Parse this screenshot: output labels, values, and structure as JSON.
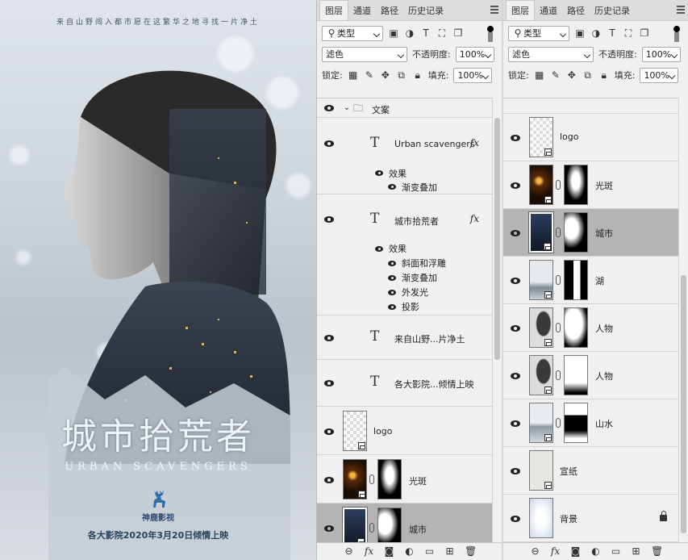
{
  "poster": {
    "tagline": "来自山野闯入都市愿在这繁华之地寻找一片净土",
    "title_cn": "城市拾荒者",
    "title_en": "URBAN SCAVENGERS",
    "brand": "神鹿影视",
    "release": "各大影院2020年3月20日倾情上映"
  },
  "panel_left": {
    "tabs": [
      "图层",
      "通道",
      "路径",
      "历史记录"
    ],
    "filter_label": "类型",
    "blend_mode": "滤色",
    "opacity_label": "不透明度:",
    "opacity_value": "100%",
    "lock_label": "锁定:",
    "fill_label": "填充:",
    "fill_value": "100%",
    "group_name": "文案",
    "layers": {
      "urban": "Urban scavengers",
      "effects_label": "效果",
      "gradient_overlay": "渐变叠加",
      "city_text": "城市拾荒者",
      "bevel": "斜面和浮雕",
      "outer_glow": "外发光",
      "drop_shadow": "投影",
      "text3": "来自山野...片净土",
      "text4": "各大影院...倾情上映",
      "logo": "logo",
      "guangban": "光斑",
      "chengshi": "城市",
      "fx": "fx"
    }
  },
  "panel_right": {
    "tabs": [
      "图层",
      "通道",
      "路径",
      "历史记录"
    ],
    "filter_label": "类型",
    "blend_mode": "滤色",
    "opacity_label": "不透明度:",
    "opacity_value": "100%",
    "lock_label": "锁定:",
    "fill_label": "填充:",
    "fill_value": "100%",
    "layers": [
      "logo",
      "光斑",
      "城市",
      "湖",
      "人物",
      "人物",
      "山水",
      "宣纸",
      "背景"
    ]
  },
  "footer_icons": [
    "link-icon",
    "fx-icon",
    "mask-icon",
    "adjustment-icon",
    "folder-icon",
    "new-layer-icon",
    "trash-icon"
  ],
  "footer_fx": "fx"
}
